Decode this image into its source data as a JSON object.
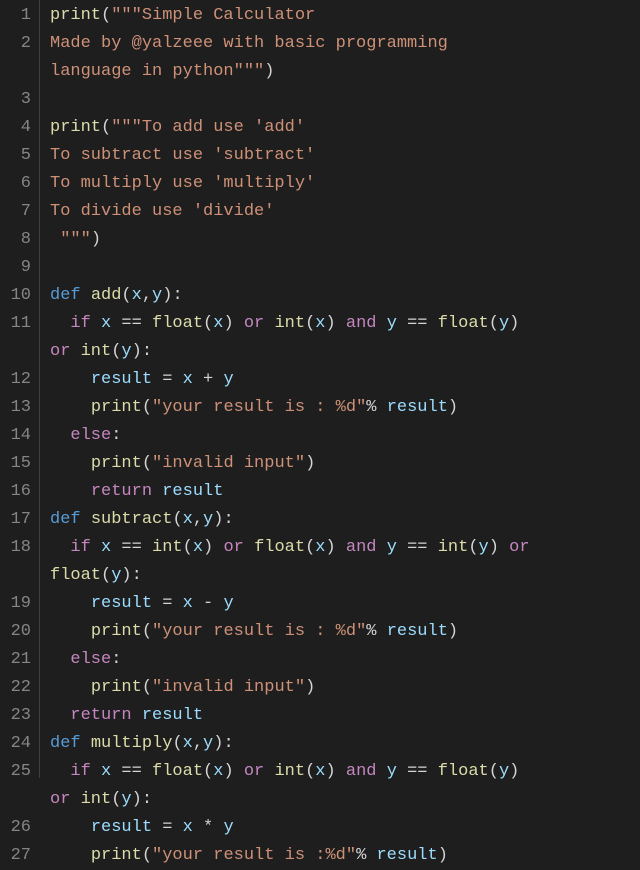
{
  "lines": [
    {
      "num": "1",
      "tokens": [
        [
          "fn",
          "print"
        ],
        [
          "paren",
          "("
        ],
        [
          "str",
          "\"\"\"Simple Calculator"
        ]
      ]
    },
    {
      "num": "2",
      "tokens": [
        [
          "str",
          "Made by @yalzeee with basic programming "
        ]
      ]
    },
    {
      "num": "",
      "tokens": [
        [
          "str",
          "language in python\"\"\""
        ],
        [
          "paren",
          ")"
        ]
      ]
    },
    {
      "num": "3",
      "tokens": [
        [
          "",
          ""
        ]
      ]
    },
    {
      "num": "4",
      "tokens": [
        [
          "fn",
          "print"
        ],
        [
          "paren",
          "("
        ],
        [
          "str",
          "\"\"\"To add use 'add'"
        ]
      ]
    },
    {
      "num": "5",
      "tokens": [
        [
          "str",
          "To subtract use 'subtract'"
        ]
      ]
    },
    {
      "num": "6",
      "tokens": [
        [
          "str",
          "To multiply use 'multiply'"
        ]
      ]
    },
    {
      "num": "7",
      "tokens": [
        [
          "str",
          "To divide use 'divide'"
        ]
      ]
    },
    {
      "num": "8",
      "tokens": [
        [
          "str",
          " \"\"\""
        ],
        [
          "paren",
          ")"
        ]
      ]
    },
    {
      "num": "9",
      "tokens": [
        [
          "",
          ""
        ]
      ]
    },
    {
      "num": "10",
      "tokens": [
        [
          "def",
          "def "
        ],
        [
          "fn",
          "add"
        ],
        [
          "paren",
          "("
        ],
        [
          "var",
          "x"
        ],
        [
          "op",
          ","
        ],
        [
          "var",
          "y"
        ],
        [
          "paren",
          ")"
        ],
        [
          "op",
          ":"
        ]
      ]
    },
    {
      "num": "11",
      "tokens": [
        [
          "",
          "  "
        ],
        [
          "kw",
          "if"
        ],
        [
          "",
          " "
        ],
        [
          "var",
          "x"
        ],
        [
          "",
          " "
        ],
        [
          "op",
          "=="
        ],
        [
          "",
          " "
        ],
        [
          "fn",
          "float"
        ],
        [
          "paren",
          "("
        ],
        [
          "var",
          "x"
        ],
        [
          "paren",
          ")"
        ],
        [
          "",
          " "
        ],
        [
          "kw",
          "or"
        ],
        [
          "",
          " "
        ],
        [
          "fn",
          "int"
        ],
        [
          "paren",
          "("
        ],
        [
          "var",
          "x"
        ],
        [
          "paren",
          ")"
        ],
        [
          "",
          " "
        ],
        [
          "kw",
          "and"
        ],
        [
          "",
          " "
        ],
        [
          "var",
          "y"
        ],
        [
          "",
          " "
        ],
        [
          "op",
          "=="
        ],
        [
          "",
          " "
        ],
        [
          "fn",
          "float"
        ],
        [
          "paren",
          "("
        ],
        [
          "var",
          "y"
        ],
        [
          "paren",
          ")"
        ]
      ]
    },
    {
      "num": "",
      "tokens": [
        [
          "kw",
          "or"
        ],
        [
          "",
          " "
        ],
        [
          "fn",
          "int"
        ],
        [
          "paren",
          "("
        ],
        [
          "var",
          "y"
        ],
        [
          "paren",
          ")"
        ],
        [
          "op",
          ":"
        ]
      ]
    },
    {
      "num": "12",
      "tokens": [
        [
          "",
          "    "
        ],
        [
          "var",
          "result"
        ],
        [
          "",
          " "
        ],
        [
          "op",
          "="
        ],
        [
          "",
          " "
        ],
        [
          "var",
          "x"
        ],
        [
          "",
          " "
        ],
        [
          "op",
          "+"
        ],
        [
          "",
          " "
        ],
        [
          "var",
          "y"
        ]
      ]
    },
    {
      "num": "13",
      "tokens": [
        [
          "",
          "    "
        ],
        [
          "fn",
          "print"
        ],
        [
          "paren",
          "("
        ],
        [
          "str",
          "\"your result is : %d\""
        ],
        [
          "op",
          "%"
        ],
        [
          "",
          " "
        ],
        [
          "var",
          "result"
        ],
        [
          "paren",
          ")"
        ]
      ]
    },
    {
      "num": "14",
      "tokens": [
        [
          "",
          "  "
        ],
        [
          "kw",
          "else"
        ],
        [
          "op",
          ":"
        ]
      ]
    },
    {
      "num": "15",
      "tokens": [
        [
          "",
          "    "
        ],
        [
          "fn",
          "print"
        ],
        [
          "paren",
          "("
        ],
        [
          "str",
          "\"invalid input\""
        ],
        [
          "paren",
          ")"
        ]
      ]
    },
    {
      "num": "16",
      "tokens": [
        [
          "",
          "    "
        ],
        [
          "kw",
          "return"
        ],
        [
          "",
          " "
        ],
        [
          "var",
          "result"
        ]
      ]
    },
    {
      "num": "17",
      "tokens": [
        [
          "def",
          "def "
        ],
        [
          "fn",
          "subtract"
        ],
        [
          "paren",
          "("
        ],
        [
          "var",
          "x"
        ],
        [
          "op",
          ","
        ],
        [
          "var",
          "y"
        ],
        [
          "paren",
          ")"
        ],
        [
          "op",
          ":"
        ]
      ]
    },
    {
      "num": "18",
      "tokens": [
        [
          "",
          "  "
        ],
        [
          "kw",
          "if"
        ],
        [
          "",
          " "
        ],
        [
          "var",
          "x"
        ],
        [
          "",
          " "
        ],
        [
          "op",
          "=="
        ],
        [
          "",
          " "
        ],
        [
          "fn",
          "int"
        ],
        [
          "paren",
          "("
        ],
        [
          "var",
          "x"
        ],
        [
          "paren",
          ")"
        ],
        [
          "",
          " "
        ],
        [
          "kw",
          "or"
        ],
        [
          "",
          " "
        ],
        [
          "fn",
          "float"
        ],
        [
          "paren",
          "("
        ],
        [
          "var",
          "x"
        ],
        [
          "paren",
          ")"
        ],
        [
          "",
          " "
        ],
        [
          "kw",
          "and"
        ],
        [
          "",
          " "
        ],
        [
          "var",
          "y"
        ],
        [
          "",
          " "
        ],
        [
          "op",
          "=="
        ],
        [
          "",
          " "
        ],
        [
          "fn",
          "int"
        ],
        [
          "paren",
          "("
        ],
        [
          "var",
          "y"
        ],
        [
          "paren",
          ")"
        ],
        [
          "",
          " "
        ],
        [
          "kw",
          "or"
        ]
      ]
    },
    {
      "num": "",
      "tokens": [
        [
          "fn",
          "float"
        ],
        [
          "paren",
          "("
        ],
        [
          "var",
          "y"
        ],
        [
          "paren",
          ")"
        ],
        [
          "op",
          ":"
        ]
      ]
    },
    {
      "num": "19",
      "tokens": [
        [
          "",
          "    "
        ],
        [
          "var",
          "result"
        ],
        [
          "",
          " "
        ],
        [
          "op",
          "="
        ],
        [
          "",
          " "
        ],
        [
          "var",
          "x"
        ],
        [
          "",
          " "
        ],
        [
          "op",
          "-"
        ],
        [
          "",
          " "
        ],
        [
          "var",
          "y"
        ]
      ]
    },
    {
      "num": "20",
      "tokens": [
        [
          "",
          "    "
        ],
        [
          "fn",
          "print"
        ],
        [
          "paren",
          "("
        ],
        [
          "str",
          "\"your result is : %d\""
        ],
        [
          "op",
          "%"
        ],
        [
          "",
          " "
        ],
        [
          "var",
          "result"
        ],
        [
          "paren",
          ")"
        ]
      ]
    },
    {
      "num": "21",
      "tokens": [
        [
          "",
          "  "
        ],
        [
          "kw",
          "else"
        ],
        [
          "op",
          ":"
        ]
      ]
    },
    {
      "num": "22",
      "tokens": [
        [
          "",
          "    "
        ],
        [
          "fn",
          "print"
        ],
        [
          "paren",
          "("
        ],
        [
          "str",
          "\"invalid input\""
        ],
        [
          "paren",
          ")"
        ]
      ]
    },
    {
      "num": "23",
      "tokens": [
        [
          "",
          "  "
        ],
        [
          "kw",
          "return"
        ],
        [
          "",
          " "
        ],
        [
          "var",
          "result"
        ]
      ]
    },
    {
      "num": "24",
      "tokens": [
        [
          "def",
          "def "
        ],
        [
          "fn",
          "multiply"
        ],
        [
          "paren",
          "("
        ],
        [
          "var",
          "x"
        ],
        [
          "op",
          ","
        ],
        [
          "var",
          "y"
        ],
        [
          "paren",
          ")"
        ],
        [
          "op",
          ":"
        ]
      ]
    },
    {
      "num": "25",
      "tokens": [
        [
          "",
          "  "
        ],
        [
          "kw",
          "if"
        ],
        [
          "",
          " "
        ],
        [
          "var",
          "x"
        ],
        [
          "",
          " "
        ],
        [
          "op",
          "=="
        ],
        [
          "",
          " "
        ],
        [
          "fn",
          "float"
        ],
        [
          "paren",
          "("
        ],
        [
          "var",
          "x"
        ],
        [
          "paren",
          ")"
        ],
        [
          "",
          " "
        ],
        [
          "kw",
          "or"
        ],
        [
          "",
          " "
        ],
        [
          "fn",
          "int"
        ],
        [
          "paren",
          "("
        ],
        [
          "var",
          "x"
        ],
        [
          "paren",
          ")"
        ],
        [
          "",
          " "
        ],
        [
          "kw",
          "and"
        ],
        [
          "",
          " "
        ],
        [
          "var",
          "y"
        ],
        [
          "",
          " "
        ],
        [
          "op",
          "=="
        ],
        [
          "",
          " "
        ],
        [
          "fn",
          "float"
        ],
        [
          "paren",
          "("
        ],
        [
          "var",
          "y"
        ],
        [
          "paren",
          ")"
        ]
      ]
    },
    {
      "num": "",
      "tokens": [
        [
          "kw",
          "or"
        ],
        [
          "",
          " "
        ],
        [
          "fn",
          "int"
        ],
        [
          "paren",
          "("
        ],
        [
          "var",
          "y"
        ],
        [
          "paren",
          ")"
        ],
        [
          "op",
          ":"
        ]
      ]
    },
    {
      "num": "26",
      "tokens": [
        [
          "",
          "    "
        ],
        [
          "var",
          "result"
        ],
        [
          "",
          " "
        ],
        [
          "op",
          "="
        ],
        [
          "",
          " "
        ],
        [
          "var",
          "x"
        ],
        [
          "",
          " "
        ],
        [
          "op",
          "*"
        ],
        [
          "",
          " "
        ],
        [
          "var",
          "y"
        ]
      ]
    },
    {
      "num": "27",
      "tokens": [
        [
          "",
          "    "
        ],
        [
          "fn",
          "print"
        ],
        [
          "paren",
          "("
        ],
        [
          "str",
          "\"your result is :%d\""
        ],
        [
          "op",
          "%"
        ],
        [
          "",
          " "
        ],
        [
          "var",
          "result"
        ],
        [
          "paren",
          ")"
        ]
      ]
    }
  ]
}
